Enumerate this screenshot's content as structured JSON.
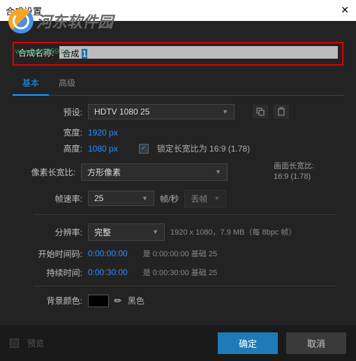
{
  "window": {
    "title": "合成设置"
  },
  "watermark": {
    "text": "河东软件园",
    "url": "www.pc0359.cn"
  },
  "name": {
    "label": "合成名称:",
    "value_prefix": "合成 ",
    "value_sel": "1"
  },
  "tabs": {
    "basic": "基本",
    "advanced": "高级"
  },
  "preset": {
    "label": "预设:",
    "value": "HDTV 1080 25"
  },
  "width": {
    "label": "宽度:",
    "value": "1920 px"
  },
  "height": {
    "label": "高度:",
    "value": "1080 px"
  },
  "lock": {
    "label": "锁定长宽比为 16:9 (1.78)"
  },
  "par": {
    "label": "像素长宽比:",
    "value": "方形像素"
  },
  "far": {
    "label": "画面长宽比:",
    "value": "16:9 (1.78)"
  },
  "fps": {
    "label": "帧速率:",
    "value": "25",
    "unit": "帧/秒",
    "drop": "丢帧"
  },
  "res": {
    "label": "分辨率:",
    "value": "完整",
    "info": "1920 x 1080，7.9 MB（每 8bpc 帧）"
  },
  "start": {
    "label": "开始时间码:",
    "value": "0:00:00:00",
    "info": "是 0:00:00:00 基础 25"
  },
  "dur": {
    "label": "持续时间:",
    "value": "0:00:30:00",
    "info": "是 0:00:30:00 基础 25"
  },
  "bg": {
    "label": "背景颜色:",
    "name": "黑色"
  },
  "footer": {
    "preview": "预览",
    "ok": "确定",
    "cancel": "取消"
  }
}
